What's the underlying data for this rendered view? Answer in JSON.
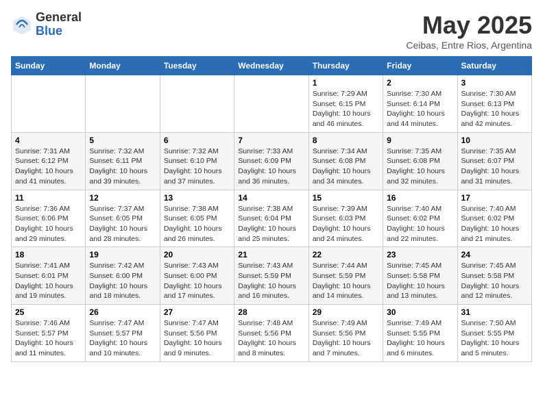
{
  "logo": {
    "general": "General",
    "blue": "Blue"
  },
  "title": "May 2025",
  "subtitle": "Ceibas, Entre Rios, Argentina",
  "days_of_week": [
    "Sunday",
    "Monday",
    "Tuesday",
    "Wednesday",
    "Thursday",
    "Friday",
    "Saturday"
  ],
  "weeks": [
    [
      {
        "day": "",
        "info": ""
      },
      {
        "day": "",
        "info": ""
      },
      {
        "day": "",
        "info": ""
      },
      {
        "day": "",
        "info": ""
      },
      {
        "day": "1",
        "info": "Sunrise: 7:29 AM\nSunset: 6:15 PM\nDaylight: 10 hours\nand 46 minutes."
      },
      {
        "day": "2",
        "info": "Sunrise: 7:30 AM\nSunset: 6:14 PM\nDaylight: 10 hours\nand 44 minutes."
      },
      {
        "day": "3",
        "info": "Sunrise: 7:30 AM\nSunset: 6:13 PM\nDaylight: 10 hours\nand 42 minutes."
      }
    ],
    [
      {
        "day": "4",
        "info": "Sunrise: 7:31 AM\nSunset: 6:12 PM\nDaylight: 10 hours\nand 41 minutes."
      },
      {
        "day": "5",
        "info": "Sunrise: 7:32 AM\nSunset: 6:11 PM\nDaylight: 10 hours\nand 39 minutes."
      },
      {
        "day": "6",
        "info": "Sunrise: 7:32 AM\nSunset: 6:10 PM\nDaylight: 10 hours\nand 37 minutes."
      },
      {
        "day": "7",
        "info": "Sunrise: 7:33 AM\nSunset: 6:09 PM\nDaylight: 10 hours\nand 36 minutes."
      },
      {
        "day": "8",
        "info": "Sunrise: 7:34 AM\nSunset: 6:08 PM\nDaylight: 10 hours\nand 34 minutes."
      },
      {
        "day": "9",
        "info": "Sunrise: 7:35 AM\nSunset: 6:08 PM\nDaylight: 10 hours\nand 32 minutes."
      },
      {
        "day": "10",
        "info": "Sunrise: 7:35 AM\nSunset: 6:07 PM\nDaylight: 10 hours\nand 31 minutes."
      }
    ],
    [
      {
        "day": "11",
        "info": "Sunrise: 7:36 AM\nSunset: 6:06 PM\nDaylight: 10 hours\nand 29 minutes."
      },
      {
        "day": "12",
        "info": "Sunrise: 7:37 AM\nSunset: 6:05 PM\nDaylight: 10 hours\nand 28 minutes."
      },
      {
        "day": "13",
        "info": "Sunrise: 7:38 AM\nSunset: 6:05 PM\nDaylight: 10 hours\nand 26 minutes."
      },
      {
        "day": "14",
        "info": "Sunrise: 7:38 AM\nSunset: 6:04 PM\nDaylight: 10 hours\nand 25 minutes."
      },
      {
        "day": "15",
        "info": "Sunrise: 7:39 AM\nSunset: 6:03 PM\nDaylight: 10 hours\nand 24 minutes."
      },
      {
        "day": "16",
        "info": "Sunrise: 7:40 AM\nSunset: 6:02 PM\nDaylight: 10 hours\nand 22 minutes."
      },
      {
        "day": "17",
        "info": "Sunrise: 7:40 AM\nSunset: 6:02 PM\nDaylight: 10 hours\nand 21 minutes."
      }
    ],
    [
      {
        "day": "18",
        "info": "Sunrise: 7:41 AM\nSunset: 6:01 PM\nDaylight: 10 hours\nand 19 minutes."
      },
      {
        "day": "19",
        "info": "Sunrise: 7:42 AM\nSunset: 6:00 PM\nDaylight: 10 hours\nand 18 minutes."
      },
      {
        "day": "20",
        "info": "Sunrise: 7:43 AM\nSunset: 6:00 PM\nDaylight: 10 hours\nand 17 minutes."
      },
      {
        "day": "21",
        "info": "Sunrise: 7:43 AM\nSunset: 5:59 PM\nDaylight: 10 hours\nand 16 minutes."
      },
      {
        "day": "22",
        "info": "Sunrise: 7:44 AM\nSunset: 5:59 PM\nDaylight: 10 hours\nand 14 minutes."
      },
      {
        "day": "23",
        "info": "Sunrise: 7:45 AM\nSunset: 5:58 PM\nDaylight: 10 hours\nand 13 minutes."
      },
      {
        "day": "24",
        "info": "Sunrise: 7:45 AM\nSunset: 5:58 PM\nDaylight: 10 hours\nand 12 minutes."
      }
    ],
    [
      {
        "day": "25",
        "info": "Sunrise: 7:46 AM\nSunset: 5:57 PM\nDaylight: 10 hours\nand 11 minutes."
      },
      {
        "day": "26",
        "info": "Sunrise: 7:47 AM\nSunset: 5:57 PM\nDaylight: 10 hours\nand 10 minutes."
      },
      {
        "day": "27",
        "info": "Sunrise: 7:47 AM\nSunset: 5:56 PM\nDaylight: 10 hours\nand 9 minutes."
      },
      {
        "day": "28",
        "info": "Sunrise: 7:48 AM\nSunset: 5:56 PM\nDaylight: 10 hours\nand 8 minutes."
      },
      {
        "day": "29",
        "info": "Sunrise: 7:49 AM\nSunset: 5:56 PM\nDaylight: 10 hours\nand 7 minutes."
      },
      {
        "day": "30",
        "info": "Sunrise: 7:49 AM\nSunset: 5:55 PM\nDaylight: 10 hours\nand 6 minutes."
      },
      {
        "day": "31",
        "info": "Sunrise: 7:50 AM\nSunset: 5:55 PM\nDaylight: 10 hours\nand 5 minutes."
      }
    ]
  ]
}
